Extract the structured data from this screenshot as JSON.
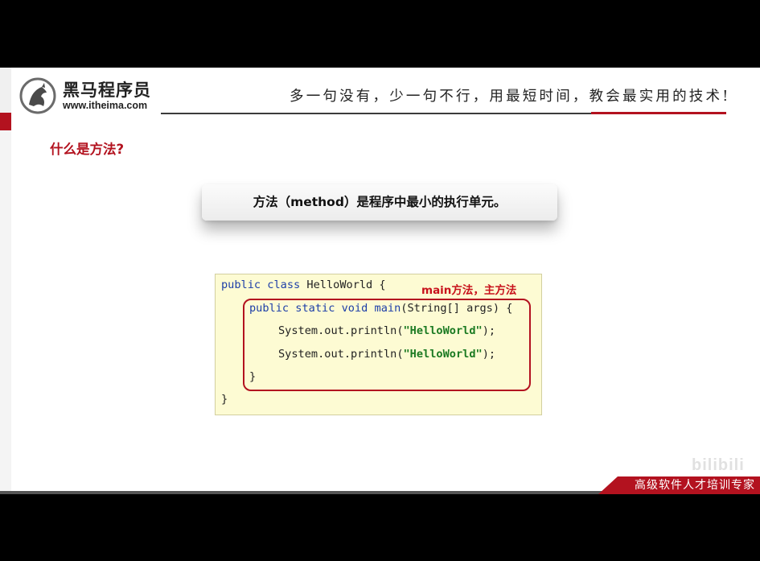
{
  "header": {
    "logo_name": "黑马程序员",
    "logo_url": "www.itheima.com",
    "slogan": "多一句没有，少一句不行，用最短时间，教会最实用的技术!"
  },
  "section_title": "什么是方法?",
  "callout_text": "方法（method）是程序中最小的执行单元。",
  "code": {
    "line1": {
      "kw": "public class",
      "rest": " HelloWorld {"
    },
    "line2": {
      "kw": "public static void",
      "fn": "main",
      "rest": "(String[] args) {"
    },
    "line3": {
      "pre": "System.out.println(",
      "str": "\"HelloWorld\"",
      "post": ");"
    },
    "line4": {
      "pre": "System.out.println(",
      "str": "\"HelloWorld\"",
      "post": ");"
    },
    "line5": "}",
    "line6": "}",
    "annotation": "main方法，主方法"
  },
  "footer": {
    "label": "高级软件人才培训专家",
    "watermark": "bilibili"
  },
  "colors": {
    "brand_red": "#b3121f",
    "code_bg": "#fdfbd3",
    "keyword_blue": "#1d3ea8",
    "string_green": "#1b7a22"
  }
}
